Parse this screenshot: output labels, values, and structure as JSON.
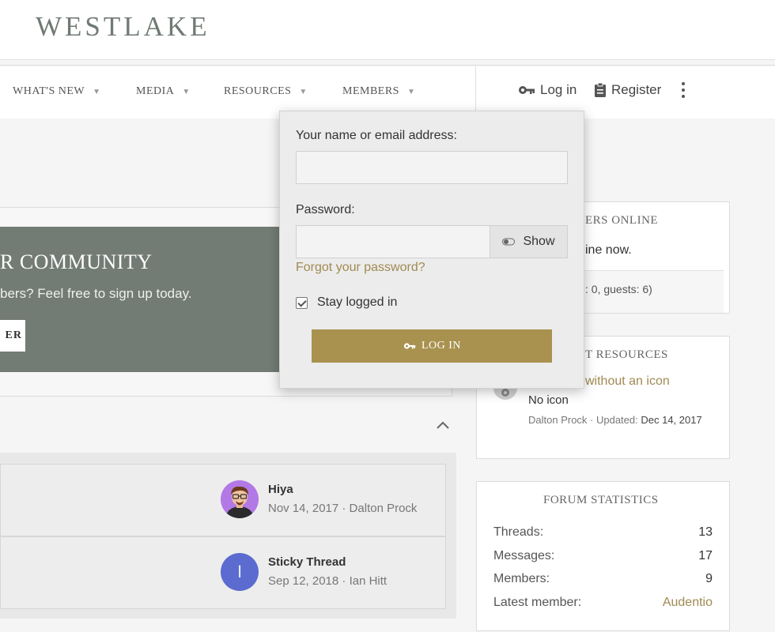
{
  "site": {
    "logo": "WESTLAKE"
  },
  "nav": {
    "items": [
      {
        "label": "WHAT'S NEW"
      },
      {
        "label": "MEDIA"
      },
      {
        "label": "RESOURCES"
      },
      {
        "label": "MEMBERS"
      }
    ],
    "login_label": "Log in",
    "register_label": "Register"
  },
  "notice": {
    "title": "R COMMUNITY",
    "text": "bers? Feel free to sign up today.",
    "button": "ER"
  },
  "threads": [
    {
      "title": "Hiya",
      "meta": "Nov 14, 2017 · Dalton Prock",
      "avatar_letter": ""
    },
    {
      "title": "Sticky Thread",
      "meta": "Sep 12, 2018 · Ian Hitt",
      "avatar_letter": "I"
    }
  ],
  "sidebar": {
    "online": {
      "heading": "ERS ONLINE",
      "text": "ine now.",
      "counts": ": 0, guests: 6)"
    },
    "resources": {
      "heading": "T RESOURCES",
      "link": "without an icon",
      "subtitle": "No icon",
      "meta_prefix": "Dalton Prock · Updated: ",
      "meta_date": "Dec 14, 2017"
    },
    "stats": {
      "heading": "FORUM STATISTICS",
      "rows": [
        {
          "label": "Threads:",
          "value": "13"
        },
        {
          "label": "Messages:",
          "value": "17"
        },
        {
          "label": "Members:",
          "value": "9"
        },
        {
          "label": "Latest member:",
          "value": "Audentio"
        }
      ]
    }
  },
  "login": {
    "name_label": "Your name or email address:",
    "name_value": "",
    "password_label": "Password:",
    "password_value": "",
    "show_label": "Show",
    "forgot_label": "Forgot your password?",
    "stay_label": "Stay logged in",
    "stay_checked": true,
    "submit_label": "LOG IN"
  },
  "colors": {
    "accent": "#a9924f",
    "notice_bg": "#737b75",
    "avatar_blue": "#5b6bd0",
    "avatar_purple": "#b279e6"
  }
}
